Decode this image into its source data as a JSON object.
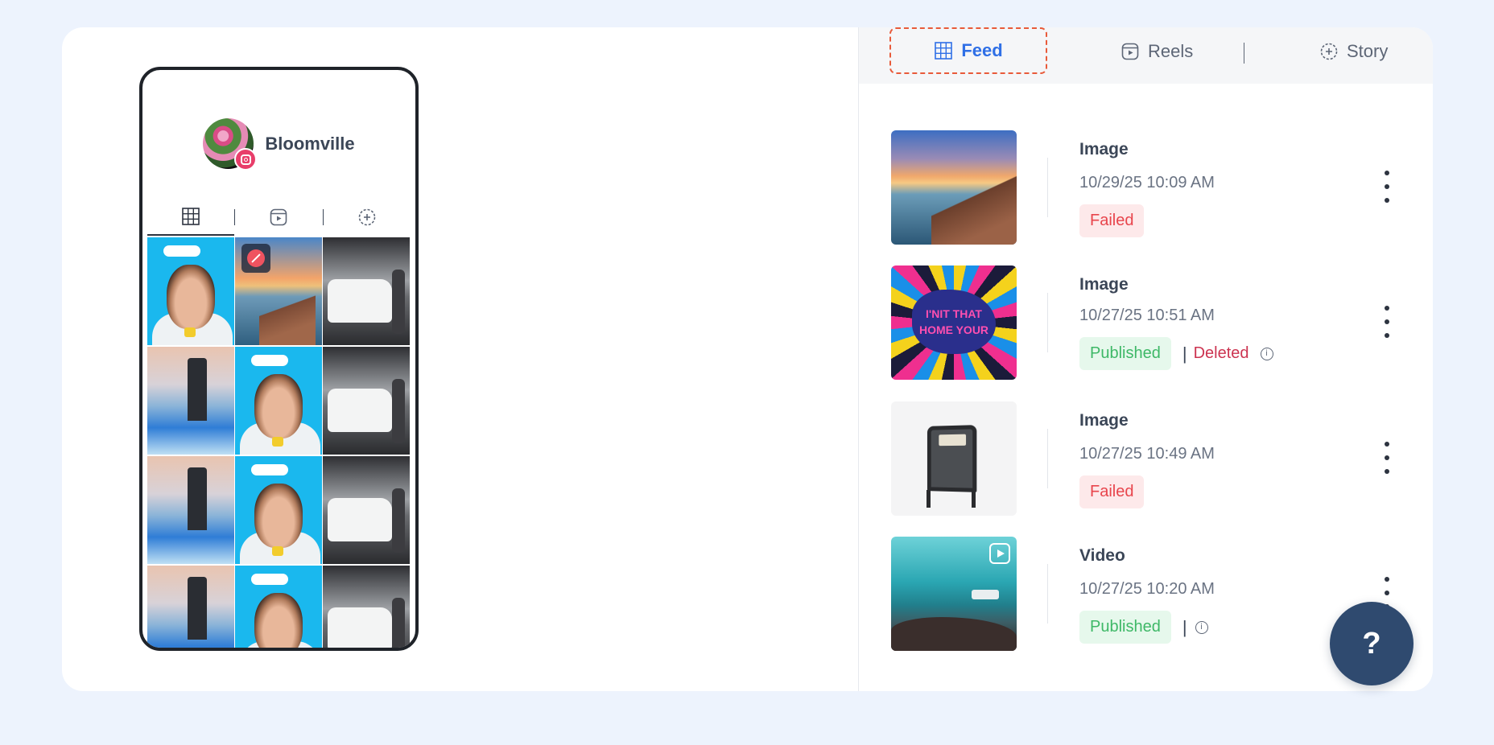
{
  "profile": {
    "name": "Bloomville"
  },
  "tabs": {
    "feed": "Feed",
    "reels": "Reels",
    "story": "Story"
  },
  "posts": [
    {
      "type": "Image",
      "time": "10/29/25 10:09 AM",
      "status": "Failed"
    },
    {
      "type": "Image",
      "time": "10/27/25 10:51 AM",
      "status": "Published",
      "extra": "Deleted"
    },
    {
      "type": "Image",
      "time": "10/27/25 10:49 AM",
      "status": "Failed"
    },
    {
      "type": "Video",
      "time": "10/27/25 10:20 AM",
      "status": "Published"
    }
  ],
  "thumb_text": {
    "line1": "I'NIT THAT",
    "line2": "HOME YOUR"
  },
  "separator": "|",
  "help": {
    "label": "?"
  },
  "colors": {
    "accent": "#2f6fe6",
    "failed": "#e8454c",
    "published": "#3eb867",
    "deleted": "#cc3350",
    "help_bg": "#2f4a6f"
  }
}
